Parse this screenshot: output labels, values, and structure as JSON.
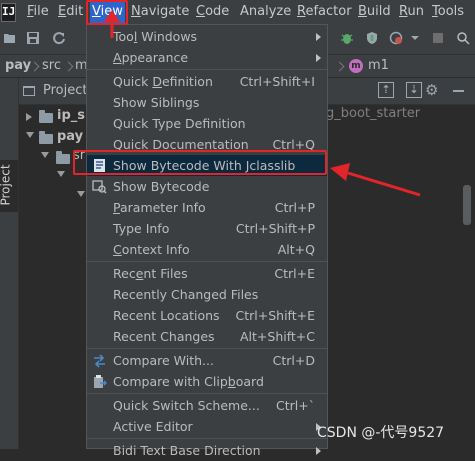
{
  "menubar": {
    "logo": "IJ",
    "items": [
      {
        "label": "File",
        "u": "F",
        "rest": "ile"
      },
      {
        "label": "Edit",
        "u": "E",
        "rest": "dit"
      },
      {
        "label": "View",
        "u": "V",
        "rest": "iew"
      },
      {
        "label": "Navigate",
        "u": "N",
        "rest": "avigate"
      },
      {
        "label": "Code",
        "u": "C",
        "rest": "ode"
      },
      {
        "label": "Analyze",
        "u": "",
        "rest": "Analyze"
      },
      {
        "label": "Refactor",
        "u": "R",
        "rest": "efactor"
      },
      {
        "label": "Build",
        "u": "B",
        "rest": "uild"
      },
      {
        "label": "Run",
        "u": "R",
        "rest": "un"
      },
      {
        "label": "Tools",
        "u": "T",
        "rest": "ools"
      }
    ]
  },
  "breadcrumb": {
    "items": [
      "pay",
      "src",
      "m",
      "m1"
    ]
  },
  "project": {
    "tab_label": "Project",
    "header_label": "Project",
    "tree": [
      "ip_sp",
      "pay",
      "sr"
    ]
  },
  "editor": {
    "visible_text": "g_boot_starter"
  },
  "view_menu": {
    "items": [
      {
        "type": "item",
        "pre": "Too",
        "u": "l",
        "post": " Windows",
        "shortcut": "",
        "submenu": true,
        "icon": ""
      },
      {
        "type": "item",
        "pre": "",
        "u": "A",
        "post": "ppearance",
        "shortcut": "",
        "submenu": true,
        "icon": ""
      },
      {
        "type": "sep"
      },
      {
        "type": "item",
        "pre": "Quick ",
        "u": "D",
        "post": "efinition",
        "shortcut": "Ctrl+Shift+I",
        "submenu": false,
        "icon": ""
      },
      {
        "type": "item",
        "pre": "Show Siblings",
        "u": "",
        "post": "",
        "shortcut": "",
        "submenu": false,
        "icon": ""
      },
      {
        "type": "item",
        "pre": "Quick Type Definition",
        "u": "",
        "post": "",
        "shortcut": "",
        "submenu": false,
        "icon": ""
      },
      {
        "type": "item",
        "pre": "Quick Documentation",
        "u": "",
        "post": "",
        "shortcut": "Ctrl+Q",
        "submenu": false,
        "icon": ""
      },
      {
        "type": "item",
        "pre": "Show Bytecode With Jclasslib",
        "u": "",
        "post": "",
        "shortcut": "",
        "submenu": false,
        "icon": "bytecode-jclasslib-icon",
        "highlight": true
      },
      {
        "type": "item",
        "pre": "Show Bytecode",
        "u": "",
        "post": "",
        "shortcut": "",
        "submenu": false,
        "icon": "show-bytecode-icon"
      },
      {
        "type": "item",
        "pre": "",
        "u": "P",
        "post": "arameter Info",
        "shortcut": "Ctrl+P",
        "submenu": false,
        "icon": ""
      },
      {
        "type": "item",
        "pre": "Type",
        "u": "",
        "post": " Info",
        "shortcut": "Ctrl+Shift+P",
        "submenu": false,
        "icon": ""
      },
      {
        "type": "item",
        "pre": "",
        "u": "C",
        "post": "ontext Info",
        "shortcut": "Alt+Q",
        "submenu": false,
        "icon": ""
      },
      {
        "type": "sep"
      },
      {
        "type": "item",
        "pre": "Rec",
        "u": "e",
        "post": "nt Files",
        "shortcut": "Ctrl+E",
        "submenu": false,
        "icon": ""
      },
      {
        "type": "item",
        "pre": "Recently Changed Files",
        "u": "",
        "post": "",
        "shortcut": "",
        "submenu": false,
        "icon": ""
      },
      {
        "type": "item",
        "pre": "Recent Locations",
        "u": "",
        "post": "",
        "shortcut": "Ctrl+Shift+E",
        "submenu": false,
        "icon": ""
      },
      {
        "type": "item",
        "pre": "Recent Changes",
        "u": "",
        "post": "",
        "shortcut": "Alt+Shift+C",
        "submenu": false,
        "icon": ""
      },
      {
        "type": "sep"
      },
      {
        "type": "item",
        "pre": "Compare With...",
        "u": "",
        "post": "",
        "shortcut": "Ctrl+D",
        "submenu": false,
        "icon": "compare-icon"
      },
      {
        "type": "item",
        "pre": "Compare with Clip",
        "u": "b",
        "post": "oard",
        "shortcut": "",
        "submenu": false,
        "icon": "clipboard-compare-icon"
      },
      {
        "type": "sep"
      },
      {
        "type": "item",
        "pre": "Quick Switch Scheme...",
        "u": "",
        "post": "",
        "shortcut": "Ctrl+`",
        "submenu": false,
        "icon": ""
      },
      {
        "type": "item",
        "pre": "Active Editor",
        "u": "",
        "post": "",
        "shortcut": "",
        "submenu": true,
        "icon": ""
      },
      {
        "type": "sep"
      },
      {
        "type": "item",
        "pre": "Bidi Text Base Direction",
        "u": "",
        "post": "",
        "shortcut": "",
        "submenu": true,
        "icon": ""
      }
    ]
  },
  "watermark": "CSDN @-代号9527",
  "colors": {
    "menubar_bg": "#3c3f41",
    "active_menu": "#2f65ca",
    "annotation_red": "#e3252a"
  }
}
